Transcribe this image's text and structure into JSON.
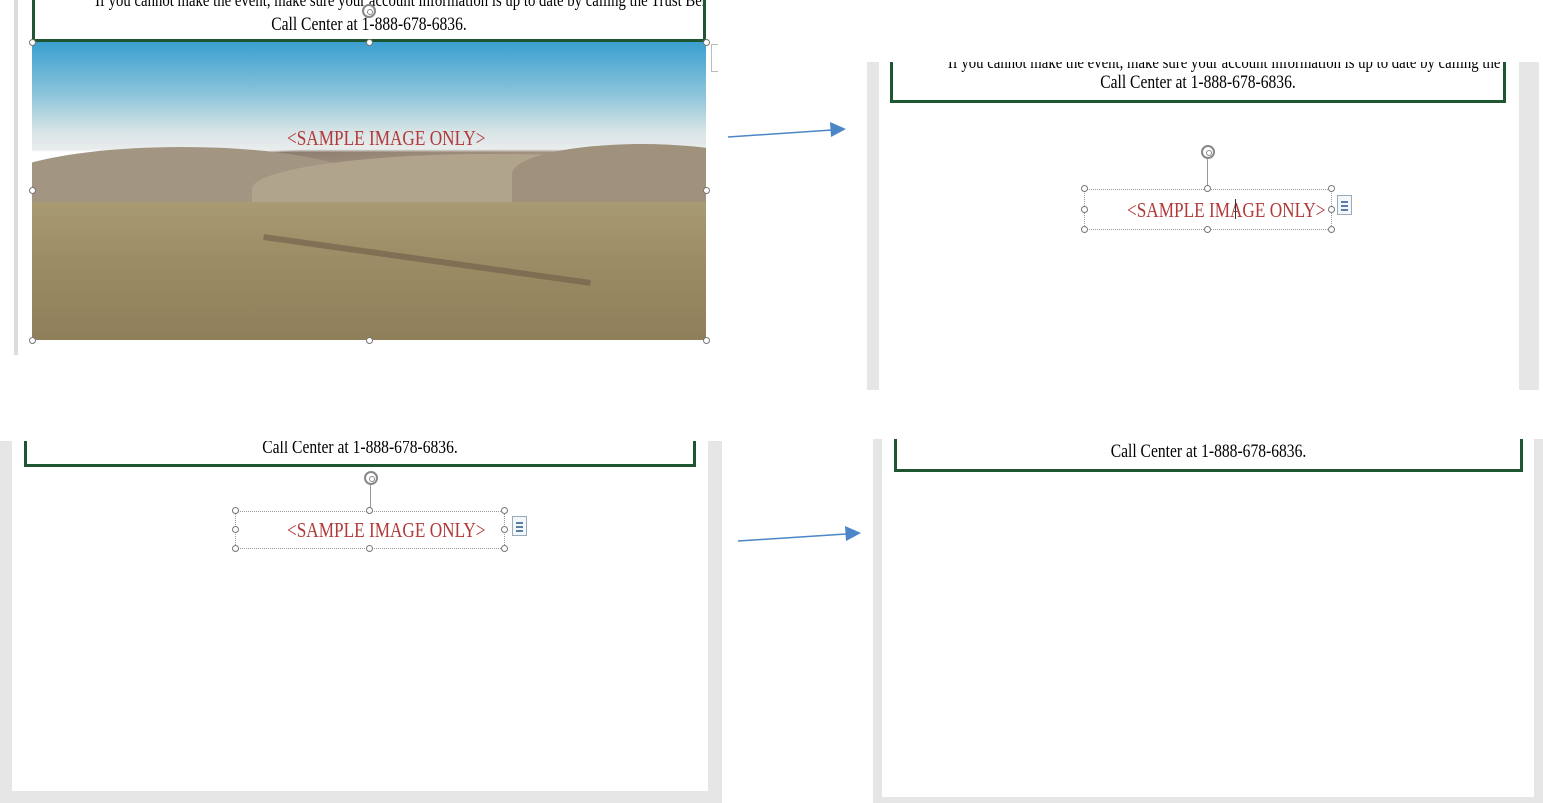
{
  "document": {
    "notice_line_cut": "If you cannot make the event, make sure your account information is up to date by calling the Trust Beneficiary",
    "notice_line_phone": "Call Center at 1-888-678-6836.",
    "sample_label": "<SAMPLE IMAGE ONLY>"
  },
  "colors": {
    "border_green": "#1e5631",
    "sample_red": "#b03a3a",
    "arrow_blue": "#4a86c8"
  },
  "icons": [
    "rotate-handle-icon",
    "layout-options-icon",
    "arrow-right-icon"
  ]
}
